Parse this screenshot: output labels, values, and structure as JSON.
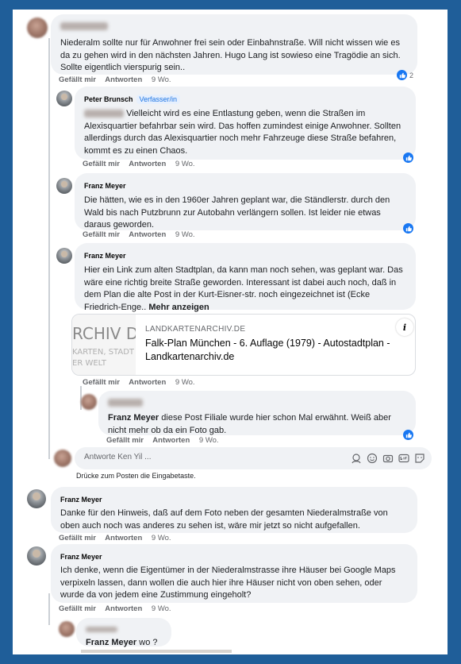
{
  "comments": [
    {
      "author": "",
      "text": "Niederalm sollte nur für Anwohner frei sein oder Einbahnstraße. Will nicht wissen wie es da zu gehen wird in den nächsten Jahren. Hugo Lang ist sowieso eine Tragödie an sich. Sollte eigentlich vierspurig sein..",
      "like": "Gefällt mir",
      "reply": "Antworten",
      "time": "9 Wo.",
      "reaction_count": "2"
    },
    {
      "author": "Peter Brunsch",
      "badge": "Verfasser/in",
      "text": "Vielleicht wird es eine Entlastung geben, wenn die Straßen im Alexisquartier befahrbar sein wird. Das hoffen zumindest einige Anwohner. Sollten allerdings durch das Alexisquartier noch mehr Fahrzeuge diese Straße befahren, kommt es zu einen Chaos.",
      "like": "Gefällt mir",
      "reply": "Antworten",
      "time": "9 Wo."
    },
    {
      "author": "Franz Meyer",
      "text": "Die hätten, wie es in den 1960er Jahren geplant war, die Ständlerstr. durch den Wald bis nach Putzbrunn zur Autobahn verlängern sollen. Ist leider nie etwas daraus geworden.",
      "like": "Gefällt mir",
      "reply": "Antworten",
      "time": "9 Wo."
    },
    {
      "author": "Franz Meyer",
      "text": "Hier ein Link zum alten Stadtplan, da kann man noch sehen, was geplant war. Das wäre eine richtig breite Straße geworden. Interessant ist dabei auch noch, daß in dem Plan die alte Post in der Kurt-Eisner-str. noch eingezeichnet ist (Ecke Friedrich-Enge..",
      "more": "Mehr anzeigen",
      "link": {
        "domain": "LANDKARTENARCHIV.DE",
        "title": "Falk-Plan München - 6. Auflage (1979) - Autostadtplan - Landkartenarchiv.de",
        "thumb_line1": "RCHIV D",
        "thumb_line2": "KARTEN, STADT",
        "thumb_line3": "ER WELT"
      },
      "like": "Gefällt mir",
      "reply": "Antworten",
      "time": "9 Wo."
    },
    {
      "mention": "Franz Meyer",
      "text": "diese Post Filiale wurde hier schon Mal erwähnt. Weiß aber nicht mehr ob da ein Foto gab.",
      "like": "Gefällt mir",
      "reply": "Antworten",
      "time": "9 Wo."
    },
    {
      "author": "Franz Meyer",
      "text": "Danke für den Hinweis, daß auf dem Foto neben der gesamten Niederalmstraße von oben auch noch was anderes zu sehen ist, wäre mir jetzt so nicht aufgefallen.",
      "like": "Gefällt mir",
      "reply": "Antworten",
      "time": "9 Wo."
    },
    {
      "author": "Franz Meyer",
      "text": "Ich denke, wenn die Eigentümer in der Niederalmstrasse ihre Häuser bei Google Maps verpixeln lassen, dann wollen die auch hier ihre Häuser nicht von oben sehen, oder wurde da von jedem eine Zustimmung eingeholt?",
      "like": "Gefällt mir",
      "reply": "Antworten",
      "time": "9 Wo."
    },
    {
      "mention": "Franz Meyer",
      "text": "wo ?"
    }
  ],
  "reply_box": {
    "placeholder": "Antworte Ken Yil ...",
    "hint": "Drücke zum Posten die Eingabetaste."
  },
  "colors": {
    "frame": "#1f5e99",
    "bubble": "#f0f2f5",
    "like_blue": "#1877f2",
    "badge_blue": "#1b74e4"
  }
}
